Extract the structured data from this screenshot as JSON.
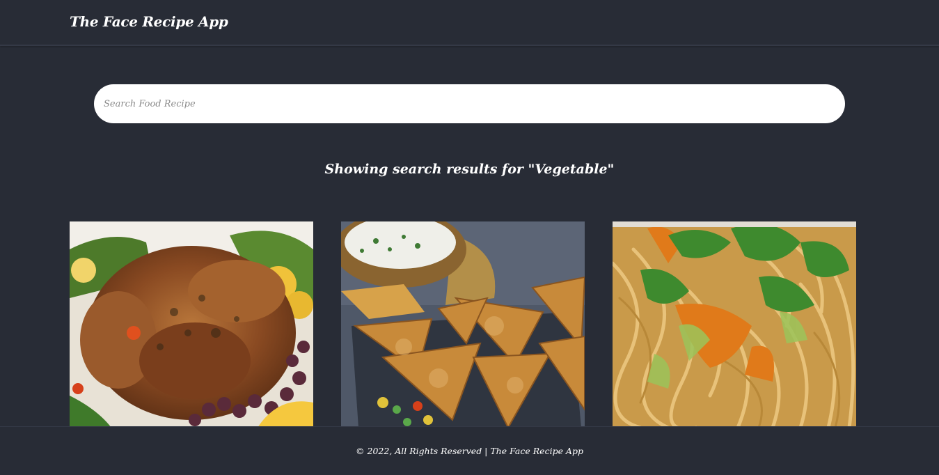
{
  "header": {
    "brand": "The Face Recipe App"
  },
  "search": {
    "placeholder": "Search Food Recipe",
    "value": ""
  },
  "results": {
    "heading": "Showing search results for \"Vegetable\"",
    "query": "Vegetable",
    "cards": [
      {
        "image_icon": "roast-chicken-image"
      },
      {
        "image_icon": "samosa-image"
      },
      {
        "image_icon": "noodles-image"
      }
    ]
  },
  "footer": {
    "text": "© 2022, All Rights Reserved | The Face Recipe App"
  },
  "colors": {
    "background": "#282c36",
    "divider": "#343946",
    "text": "#ffffff",
    "search_bg": "#ffffff"
  }
}
